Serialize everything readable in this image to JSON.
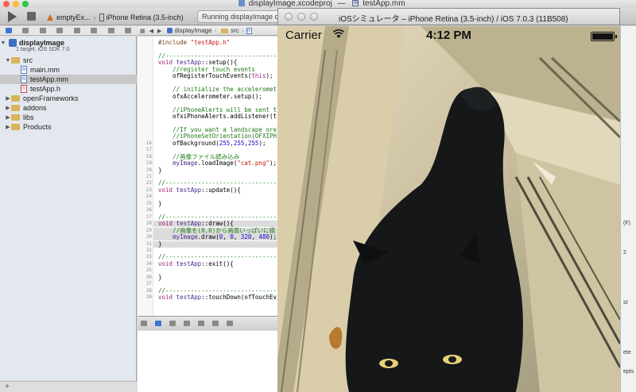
{
  "window": {
    "title_project": "displayImage.xcodeproj",
    "title_sep": "—",
    "title_file": "testApp.mm"
  },
  "toolbar": {
    "scheme": "emptyEx...",
    "device": "iPhone Retina (3.5-inch)",
    "activity_status": "Running displayImage on iPhone Retina"
  },
  "navigator": {
    "project_name": "displayImage",
    "project_subtitle": "1 target, iOS SDK 7.0",
    "items": [
      {
        "label": "src",
        "kind": "folder"
      },
      {
        "label": "main.mm",
        "kind": "m"
      },
      {
        "label": "testApp.mm",
        "kind": "m",
        "selected": true
      },
      {
        "label": "testApp.h",
        "kind": "h"
      },
      {
        "label": "openFrameworks",
        "kind": "folder"
      },
      {
        "label": "addons",
        "kind": "folder"
      },
      {
        "label": "libs",
        "kind": "folder"
      },
      {
        "label": "Products",
        "kind": "folder"
      }
    ],
    "glyph_m": "m",
    "glyph_h": "h"
  },
  "editor": {
    "jump_bar": [
      "displayImage",
      "src",
      "m"
    ],
    "code": [
      {
        "n": "",
        "html": "<span class='c-pp'>#include</span> <span class='c-str'>\"testApp.h\"</span>"
      },
      {
        "n": "",
        "html": ""
      },
      {
        "n": "",
        "html": "<span class='c-cm'>//--------------------------------</span>"
      },
      {
        "n": "",
        "html": "<span class='c-kw'>void</span> <span class='c-tp'>testApp</span>::setup(){"
      },
      {
        "n": "",
        "html": "    <span class='c-cm'>//register touch events</span>"
      },
      {
        "n": "",
        "html": "    ofRegisterTouchEvents(<span class='c-kw'>this</span>);"
      },
      {
        "n": "",
        "html": ""
      },
      {
        "n": "",
        "html": "    <span class='c-cm'>// initialize the acceleromet</span>"
      },
      {
        "n": "",
        "html": "    ofxAccelerometer.setup();"
      },
      {
        "n": "",
        "html": ""
      },
      {
        "n": "",
        "html": "    <span class='c-cm'>//iPhoneAlerts will be sent t</span>"
      },
      {
        "n": "",
        "html": "    ofxiPhoneAlerts.addListener(t"
      },
      {
        "n": "",
        "html": ""
      },
      {
        "n": "",
        "html": "    <span class='c-cm'>//If you want a landscape ore</span>"
      },
      {
        "n": "",
        "html": "    <span class='c-cm'>//iPhoneSetOrientation(OFXIPH</span>"
      },
      {
        "n": "16",
        "html": "    ofBackground(<span class='c-num'>255</span>,<span class='c-num'>255</span>,<span class='c-num'>255</span>);"
      },
      {
        "n": "17",
        "html": ""
      },
      {
        "n": "18",
        "html": "    <span class='c-cm'>//画像ファイル読み込み</span>"
      },
      {
        "n": "19",
        "html": "    <span class='c-tp'>myImage</span>.loadImage(<span class='c-str'>\"cat.png\"</span>);"
      },
      {
        "n": "20",
        "html": "}"
      },
      {
        "n": "21",
        "html": ""
      },
      {
        "n": "22",
        "html": "<span class='c-cm'>//--------------------------------</span>"
      },
      {
        "n": "23",
        "html": "<span class='c-kw'>void</span> <span class='c-tp'>testApp</span>::update(){"
      },
      {
        "n": "24",
        "html": ""
      },
      {
        "n": "25",
        "html": "}"
      },
      {
        "n": "26",
        "html": ""
      },
      {
        "n": "27",
        "html": "<span class='c-cm'>//--------------------------------</span>"
      },
      {
        "n": "28",
        "html": "<span class='c-kw'>void</span> <span class='c-tp'>testApp</span>::draw(){",
        "hl": true
      },
      {
        "n": "29",
        "html": "    <span class='c-cm'>//画像を(0,0)から画面いっぱいに描</span>",
        "hl": true
      },
      {
        "n": "30",
        "html": "    <span class='c-tp'>myImage</span>.draw(<span class='c-num'>0</span>, <span class='c-num'>0</span>, <span class='c-num'>320</span>, <span class='c-num'>480</span>);",
        "hl": true
      },
      {
        "n": "31",
        "html": "}",
        "hl": true
      },
      {
        "n": "32",
        "html": ""
      },
      {
        "n": "33",
        "html": "<span class='c-cm'>//--------------------------------</span>"
      },
      {
        "n": "34",
        "html": "<span class='c-kw'>void</span> <span class='c-tp'>testApp</span>::exit(){"
      },
      {
        "n": "35",
        "html": ""
      },
      {
        "n": "36",
        "html": "}"
      },
      {
        "n": "37",
        "html": ""
      },
      {
        "n": "38",
        "html": "<span class='c-cm'>//--------------------------------</span>"
      },
      {
        "n": "39",
        "html": "<span class='c-kw'>void</span> <span class='c-tp'>testApp</span>::touchDown(ofTouchEv"
      }
    ]
  },
  "back_window": {
    "fragments": [
      "(F)",
      "2",
      "st",
      "ete",
      "epts"
    ]
  },
  "simulator": {
    "title": "iOSシミュレータ – iPhone Retina (3.5-inch) / iOS 7.0.3 (11B508)",
    "carrier": "Carrier",
    "time": "4:12 PM",
    "battery_level": 1.0
  },
  "colors": {
    "xcode_accent": "#3a76d0",
    "close": "#ff5f57",
    "minimize": "#febc2e",
    "zoom": "#28c840"
  }
}
